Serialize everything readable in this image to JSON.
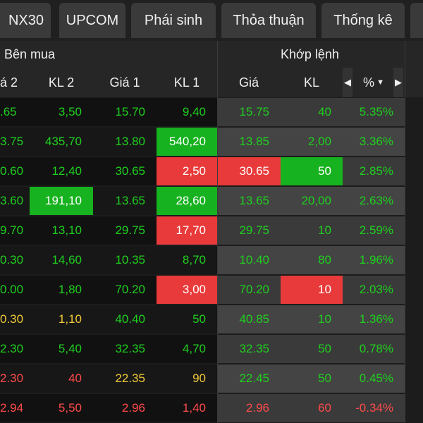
{
  "tabs": [
    {
      "label": "NX30"
    },
    {
      "label": "UPCOM"
    },
    {
      "label": "Phái sinh"
    },
    {
      "label": "Thỏa thuận"
    },
    {
      "label": "Thống kê"
    }
  ],
  "groups": {
    "buy": "Bên mua",
    "match": "Khớp lệnh"
  },
  "columns": {
    "gia2": "á 2",
    "kl2": "KL 2",
    "gia1": "Giá 1",
    "kl1": "KL 1",
    "gia": "Giá",
    "kl": "KL",
    "pct": "%",
    "sort_icon": "caret-down-icon",
    "left_arrow": "caret-left-icon",
    "right_arrow": "caret-right-icon"
  },
  "colors": {
    "up": "#1fd01f",
    "down": "#ff4a4a",
    "ref": "#f0c93a",
    "flash_up": "#17b21f",
    "flash_down": "#e83a3a"
  },
  "rows": [
    {
      "gia2": ".65",
      "gia2_c": "g",
      "kl2": "3,50",
      "kl2_c": "g",
      "gia1": "15.70",
      "gia1_c": "g",
      "kl1": "9,40",
      "kl1_c": "g",
      "gia": "15.75",
      "gia_c": "g",
      "kl": "40",
      "kl_c": "g",
      "pct": "5.35%",
      "pct_c": "g"
    },
    {
      "gia2": "3.75",
      "gia2_c": "g",
      "kl2": "435,70",
      "kl2_c": "g",
      "gia1": "13.80",
      "gia1_c": "g",
      "kl1": "540,20",
      "kl1_c": "bg-g",
      "gia": "13.85",
      "gia_c": "g",
      "kl": "2,00",
      "kl_c": "g",
      "pct": "3.36%",
      "pct_c": "g"
    },
    {
      "gia2": "0.60",
      "gia2_c": "g",
      "kl2": "12,40",
      "kl2_c": "g",
      "gia1": "30.65",
      "gia1_c": "g",
      "kl1": "2,50",
      "kl1_c": "bg-r",
      "gia": "30.65",
      "gia_c": "bg-r",
      "kl": "50",
      "kl_c": "bg-g",
      "pct": "2.85%",
      "pct_c": "g"
    },
    {
      "gia2": "3.60",
      "gia2_c": "g",
      "kl2": "191,10",
      "kl2_c": "bg-g",
      "gia1": "13.65",
      "gia1_c": "g",
      "kl1": "28,60",
      "kl1_c": "bg-g",
      "gia": "13.65",
      "gia_c": "g",
      "kl": "20,00",
      "kl_c": "g",
      "pct": "2.63%",
      "pct_c": "g"
    },
    {
      "gia2": "9.70",
      "gia2_c": "g",
      "kl2": "13,10",
      "kl2_c": "g",
      "gia1": "29.75",
      "gia1_c": "g",
      "kl1": "17,70",
      "kl1_c": "bg-r",
      "gia": "29.75",
      "gia_c": "g",
      "kl": "10",
      "kl_c": "g",
      "pct": "2.59%",
      "pct_c": "g"
    },
    {
      "gia2": "0.30",
      "gia2_c": "g",
      "kl2": "14,60",
      "kl2_c": "g",
      "gia1": "10.35",
      "gia1_c": "g",
      "kl1": "8,70",
      "kl1_c": "g",
      "gia": "10.40",
      "gia_c": "g",
      "kl": "80",
      "kl_c": "g",
      "pct": "1.96%",
      "pct_c": "g"
    },
    {
      "gia2": "0.00",
      "gia2_c": "g",
      "kl2": "1,80",
      "kl2_c": "g",
      "gia1": "70.20",
      "gia1_c": "g",
      "kl1": "3,00",
      "kl1_c": "bg-r",
      "gia": "70.20",
      "gia_c": "g",
      "kl": "10",
      "kl_c": "bg-r",
      "pct": "2.03%",
      "pct_c": "g"
    },
    {
      "gia2": "0.30",
      "gia2_c": "y",
      "kl2": "1,10",
      "kl2_c": "y",
      "gia1": "40.40",
      "gia1_c": "g",
      "kl1": "50",
      "kl1_c": "g",
      "gia": "40.85",
      "gia_c": "g",
      "kl": "10",
      "kl_c": "g",
      "pct": "1.36%",
      "pct_c": "g"
    },
    {
      "gia2": "2.30",
      "gia2_c": "g",
      "kl2": "5,40",
      "kl2_c": "g",
      "gia1": "32.35",
      "gia1_c": "g",
      "kl1": "4,70",
      "kl1_c": "g",
      "gia": "32.35",
      "gia_c": "g",
      "kl": "50",
      "kl_c": "g",
      "pct": "0.78%",
      "pct_c": "g"
    },
    {
      "gia2": "2.30",
      "gia2_c": "r",
      "kl2": "40",
      "kl2_c": "r",
      "gia1": "22.35",
      "gia1_c": "y",
      "kl1": "90",
      "kl1_c": "y",
      "gia": "22.45",
      "gia_c": "g",
      "kl": "50",
      "kl_c": "g",
      "pct": "0.45%",
      "pct_c": "g"
    },
    {
      "gia2": "2.94",
      "gia2_c": "r",
      "kl2": "5,50",
      "kl2_c": "r",
      "gia1": "2.96",
      "gia1_c": "r",
      "kl1": "1,40",
      "kl1_c": "r",
      "gia": "2.96",
      "gia_c": "r",
      "kl": "60",
      "kl_c": "r",
      "pct": "-0.34%",
      "pct_c": "r"
    }
  ]
}
